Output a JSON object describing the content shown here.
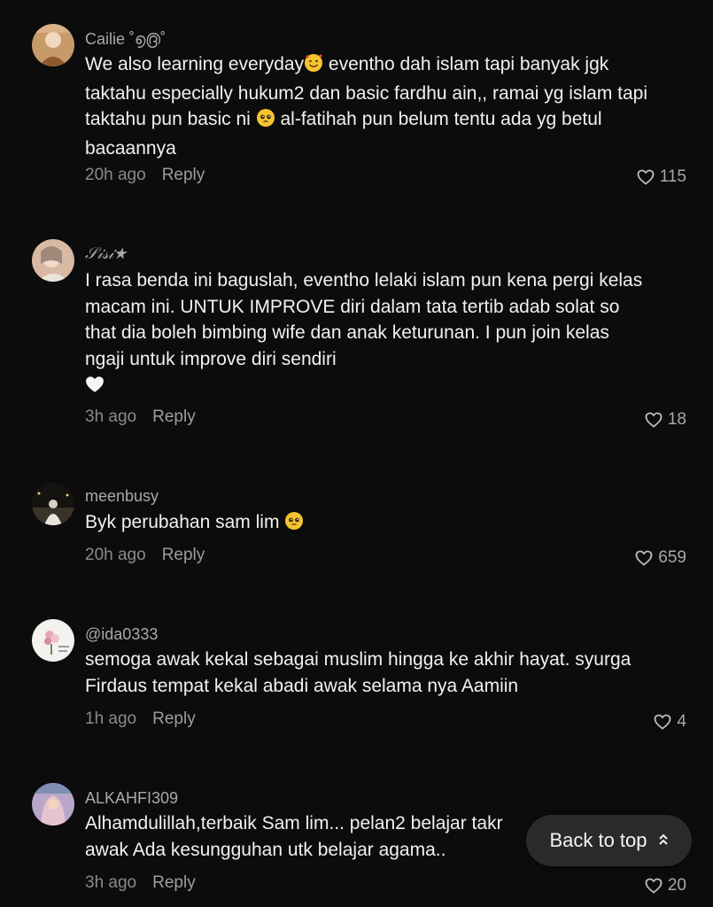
{
  "comments": [
    {
      "username": "Cailie ˚൭൫˚",
      "text_parts": [
        "We also learning everyday",
        " eventho dah islam tapi banyak jgk taktahu especially hukum2 dan basic fardhu ain,, ramai yg islam tapi taktahu pun basic ni ",
        " al-fatihah pun belum tentu ada yg betul bacaannya"
      ],
      "time": "20h ago",
      "reply": "Reply",
      "likes": "115"
    },
    {
      "username": "𝒮𝒾𝓈𝒾★",
      "text_parts": [
        "I rasa benda ini baguslah, eventho lelaki islam pun kena pergi kelas macam ini. UNTUK IMPROVE diri dalam tata tertib adab solat so that dia boleh bimbing wife dan anak keturunan. I pun join kelas ngaji untuk improve diri sendiri ",
        ""
      ],
      "time": "3h ago",
      "reply": "Reply",
      "likes": "18"
    },
    {
      "username": "meenbusy",
      "text_parts": [
        "Byk perubahan sam lim ",
        ""
      ],
      "time": "20h ago",
      "reply": "Reply",
      "likes": "659"
    },
    {
      "username": "@ida0333",
      "text_parts": [
        "semoga awak kekal sebagai muslim hingga ke akhir hayat. syurga Firdaus tempat kekal abadi awak selama nya Aamiin"
      ],
      "time": "1h ago",
      "reply": "Reply",
      "likes": "4"
    },
    {
      "username": "ALKAHFI309",
      "text_parts": [
        "Alhamdulillah,terbaik Sam lim... pelan2 belajar takr",
        "awak Ada kesungguhan utk belajar agama.."
      ],
      "time": "3h ago",
      "reply": "Reply",
      "likes": "20"
    }
  ],
  "back_to_top": {
    "label": "Back to top"
  },
  "icons": {
    "like": "heart-outline-icon",
    "back_to_top": "double-chevron-up-icon",
    "emoji_smile_hearts": "smiling-face-with-hearts-emoji",
    "emoji_pleading": "pleading-face-emoji",
    "emoji_white_heart": "white-heart-emoji"
  },
  "colors": {
    "background": "#0c0c0c",
    "text": "#f1f1f1",
    "muted": "#8a8a8a",
    "button_bg": "#2a2a2a"
  }
}
